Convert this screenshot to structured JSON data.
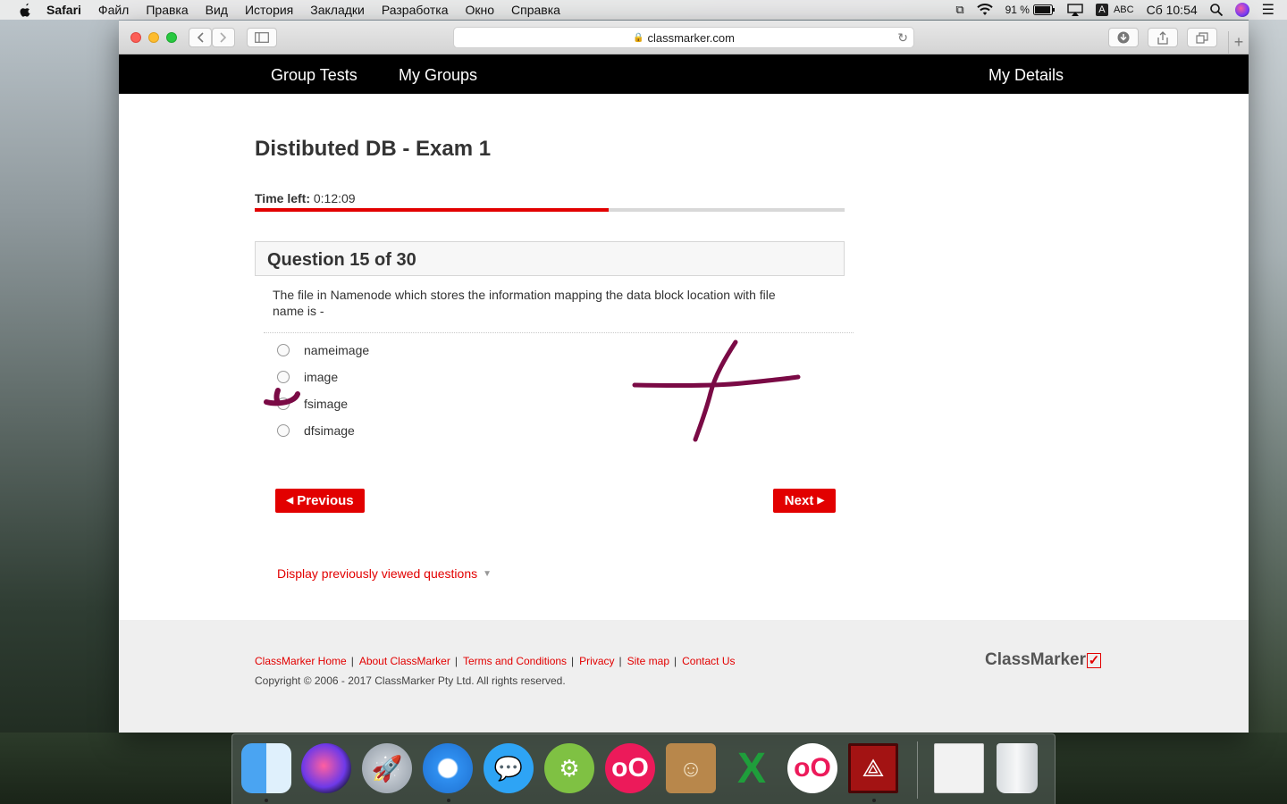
{
  "menubar": {
    "app_name": "Safari",
    "items": [
      "Файл",
      "Правка",
      "Вид",
      "История",
      "Закладки",
      "Разработка",
      "Окно",
      "Справка"
    ],
    "battery": "91 %",
    "keyboard": "ABC",
    "input_letter": "A",
    "clock": "Сб 10:54"
  },
  "browser": {
    "url": "classmarker.com"
  },
  "nav": {
    "group_tests": "Group Tests",
    "my_groups": "My Groups",
    "my_details": "My Details"
  },
  "exam": {
    "title": "Distibuted DB - Exam 1",
    "time_left_label": "Time left:",
    "time_left_value": "0:12:09",
    "time_progress_fraction": 0.6,
    "question_header": "Question 15 of 30",
    "question_text": "The file in Namenode which stores the information mapping the data block location with file name is -",
    "options": [
      "nameimage",
      "image",
      "fsimage",
      "dfsimage"
    ],
    "previous_label": "Previous",
    "next_label": "Next",
    "previously_viewed_label": "Display previously viewed questions"
  },
  "footer": {
    "links": [
      "ClassMarker Home",
      "About ClassMarker",
      "Terms and Conditions",
      "Privacy",
      "Site map",
      "Contact Us"
    ],
    "copyright": "Copyright © 2006 - 2017 ClassMarker Pty Ltd. All rights reserved.",
    "logo_text": "ClassMarker"
  },
  "colors": {
    "accent": "#e20000",
    "navbar": "#000000",
    "annotation": "#7a0a45"
  },
  "dock": {
    "apps": [
      "finder-icon",
      "siri-icon",
      "launchpad-icon",
      "safari-icon",
      "messenger-icon",
      "android-studio-icon",
      "flickr-icon",
      "contacts-icon",
      "excel-icon",
      "flickr-icon",
      "acrobat-icon",
      "downloads-stack-icon",
      "trash-icon"
    ]
  }
}
